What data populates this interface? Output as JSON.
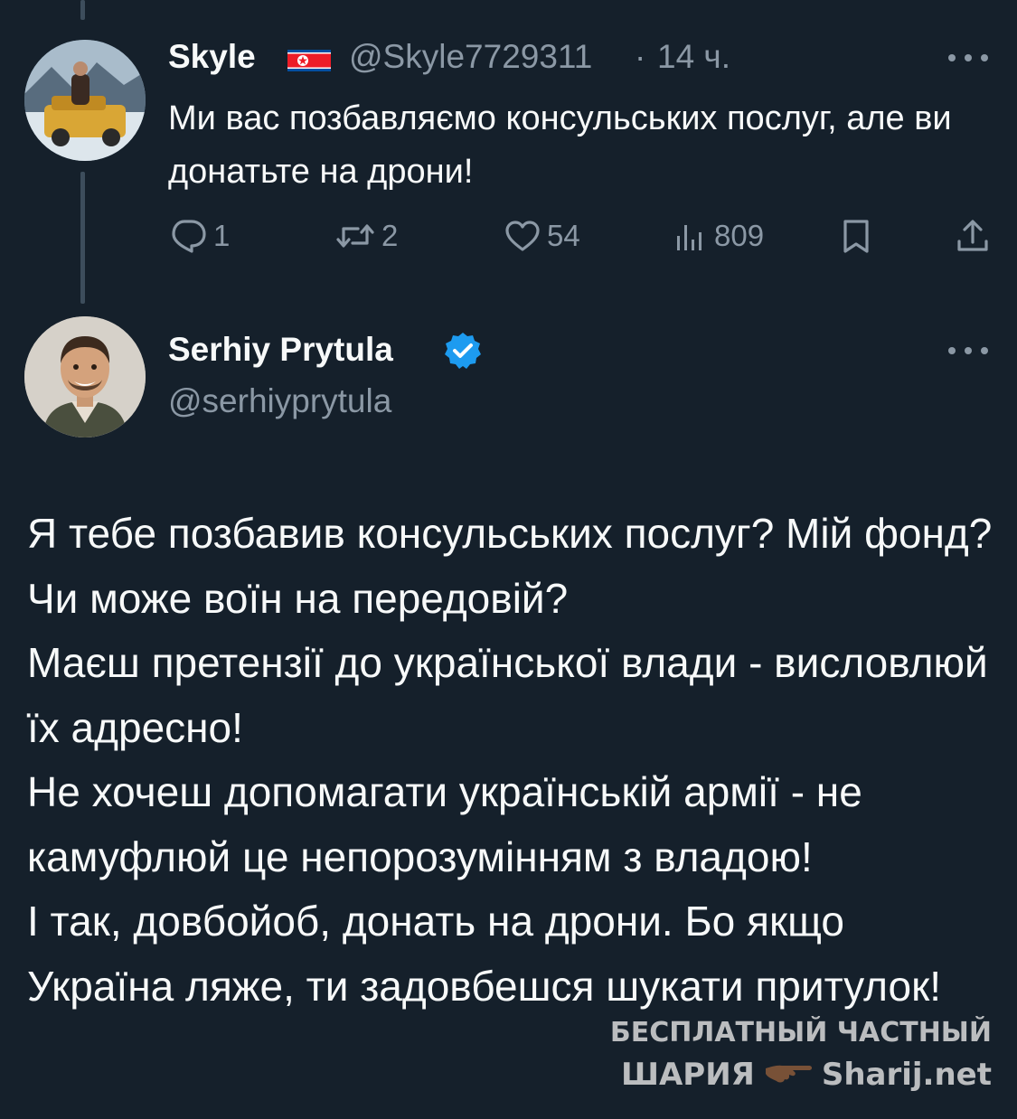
{
  "reply": {
    "display_name": "Skyle",
    "flag_icon": "north-korea-flag-icon",
    "handle": "@Skyle7729311",
    "separator": "·",
    "time": "14 ч.",
    "text": "Ми вас позбавляємо консульських послуг, але ви донатьте на дрони!",
    "stats": {
      "replies": "1",
      "reposts": "2",
      "likes": "54",
      "views": "809"
    }
  },
  "main_tweet": {
    "display_name": "Serhiy Prytula",
    "verified_icon": "verified-badge-icon",
    "handle": "@serhiyprytula",
    "paragraphs": [
      "Я тебе позбавив консульських послуг? Мій фонд? Чи може воїн на передовій?",
      "Маєш претензії до української влади - висловлюй їх адресно!",
      "Не хочеш допомагати українській армії - не камуфлюй це непорозумінням з владою!",
      "І так, довбойоб, донать на дрони. Бо якщо Україна ляже, ти задовбешся шукати притулок!"
    ]
  },
  "watermark": {
    "line1": "БЕСПЛАТНЫЙ ЧАСТНЫЙ",
    "line2_left": "ШАРИЯ",
    "line2_right": "Sharij.net"
  },
  "colors": {
    "background": "#15202b",
    "text": "#f7f9f9",
    "muted": "#8b98a5",
    "verified": "#1d9bf0",
    "thread_line": "#3d4d5c"
  }
}
